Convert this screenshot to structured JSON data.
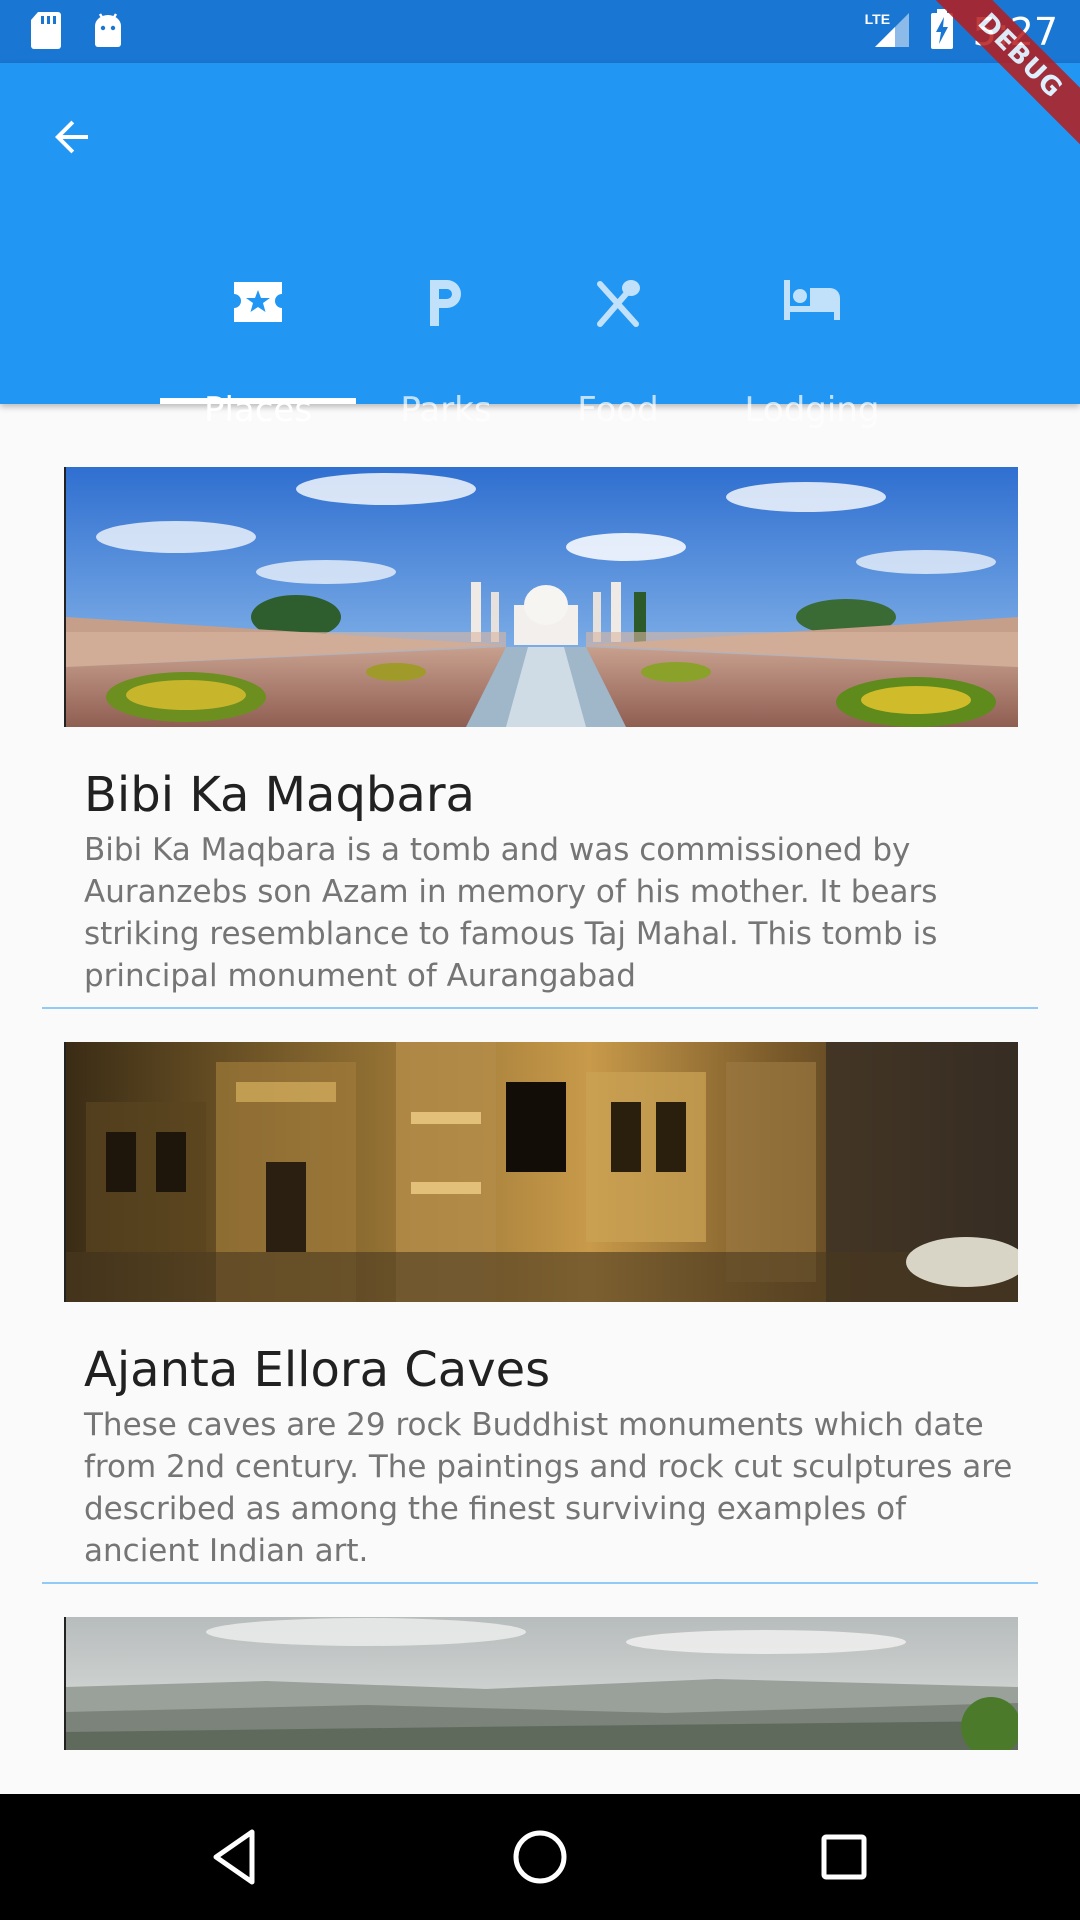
{
  "status_bar": {
    "time": "5:27",
    "network_label": "LTE",
    "icons": [
      "sd-card-icon",
      "android-icon",
      "signal-icon",
      "battery-charging-icon"
    ]
  },
  "debug_banner": "DEBUG",
  "app_bar": {
    "back_icon": "arrow-back-icon",
    "tabs": [
      {
        "label": "Places",
        "icon": "local-activity-icon",
        "selected": true
      },
      {
        "label": "Parks",
        "icon": "local-parking-icon",
        "selected": false
      },
      {
        "label": "Food",
        "icon": "restaurant-icon",
        "selected": false
      },
      {
        "label": "Lodging",
        "icon": "hotel-icon",
        "selected": false
      }
    ]
  },
  "places": [
    {
      "title": "Bibi Ka Maqbara",
      "description": "Bibi Ka Maqbara is a tomb and was commissioned by Auranzebs son Azam in memory of his mother. It bears striking resemblance to famous Taj Mahal. This tomb is principal monument of Aurangabad"
    },
    {
      "title": "Ajanta Ellora Caves",
      "description": "These caves are 29 rock Buddhist monuments which date from 2nd century. The paintings and rock cut sculptures are described as among the finest surviving examples of ancient Indian art."
    }
  ],
  "colors": {
    "status_bar": "#1976d2",
    "app_bar": "#2196f3",
    "divider": "#90caf9",
    "background": "#fafafa"
  },
  "nav_bar": {
    "icons": [
      "back-triangle-icon",
      "home-circle-icon",
      "recents-square-icon"
    ]
  }
}
